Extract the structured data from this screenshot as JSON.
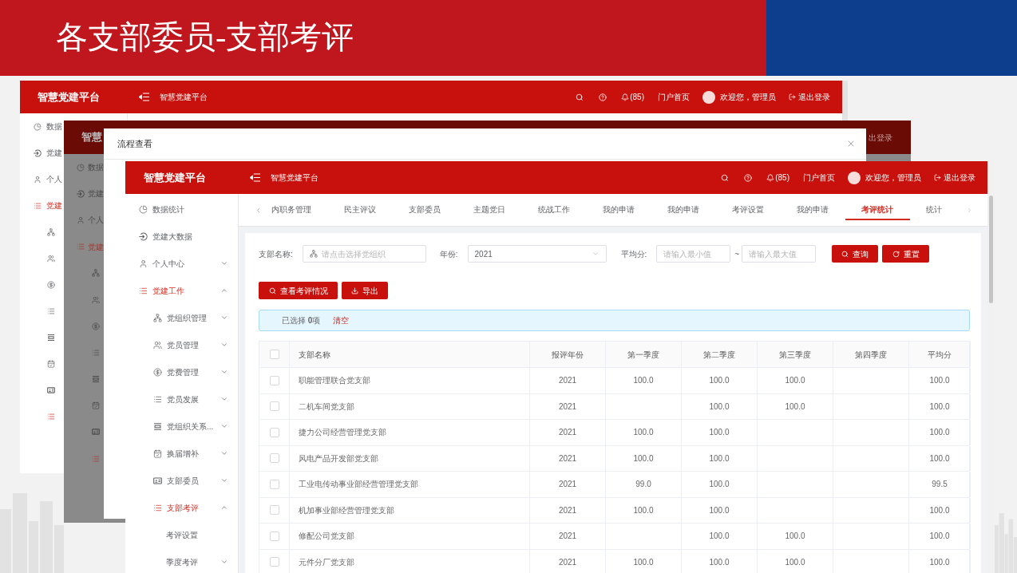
{
  "slide": {
    "title": "各支部委员-支部考评"
  },
  "back_window": {
    "header": {
      "logo": "智慧党建平台",
      "breadcrumb": "智慧党建平台",
      "notifications": "(85)",
      "portal_link": "门户首页",
      "greeting": "欢迎您，管理员",
      "logout": "退出登录"
    },
    "sidebar": [
      {
        "label": "数据",
        "active": false
      },
      {
        "label": "党建",
        "active": false
      },
      {
        "label": "个人",
        "active": false
      },
      {
        "label": "党建",
        "active": true,
        "children": [
          {
            "active": false
          },
          {
            "active": false
          },
          {
            "active": false
          },
          {
            "active": false
          },
          {
            "active": false
          },
          {
            "active": false
          },
          {
            "active": false
          },
          {
            "active": true
          }
        ]
      }
    ]
  },
  "dimmed_window": {
    "header": {
      "logo": "智慧",
      "logout": "出登录"
    },
    "sidebar": [
      {
        "label": "数据",
        "active": false
      },
      {
        "label": "党建",
        "active": false
      },
      {
        "label": "个人",
        "active": false
      },
      {
        "label": "党建",
        "active": true,
        "children": [
          {
            "active": false
          },
          {
            "active": false
          },
          {
            "active": false
          },
          {
            "active": false
          },
          {
            "active": false
          },
          {
            "active": false
          },
          {
            "active": false
          },
          {
            "active": true
          }
        ]
      }
    ]
  },
  "dialog": {
    "title": "流程查看"
  },
  "front_window": {
    "header": {
      "logo": "智慧党建平台",
      "breadcrumb": "智慧党建平台",
      "notifications": "(85)",
      "portal_link": "门户首页",
      "greeting": "欢迎您，管理员",
      "logout": "退出登录"
    },
    "sidebar": [
      {
        "label": "数据统计",
        "active": false
      },
      {
        "label": "党建大数据",
        "active": false
      },
      {
        "label": "个人中心",
        "active": false,
        "expanded": false
      },
      {
        "label": "党建工作",
        "active": true,
        "expanded": true,
        "children": [
          {
            "label": "党组织管理",
            "active": false,
            "expanded": false
          },
          {
            "label": "党员管理",
            "active": false,
            "expanded": false
          },
          {
            "label": "党费管理",
            "active": false,
            "expanded": false
          },
          {
            "label": "党员发展",
            "active": false,
            "expanded": false
          },
          {
            "label": "党组织关系...",
            "active": false,
            "expanded": false
          },
          {
            "label": "换届增补",
            "active": false,
            "expanded": false
          },
          {
            "label": "支部委员",
            "active": false,
            "expanded": false
          },
          {
            "label": "支部考评",
            "active": true,
            "expanded": true,
            "children": [
              {
                "label": "考评设置",
                "active": false
              },
              {
                "label": "季度考评",
                "active": false,
                "expanded": false
              }
            ]
          }
        ]
      }
    ],
    "tabs": [
      {
        "label": "内职务管理",
        "selected": false
      },
      {
        "label": "民主评议",
        "selected": false
      },
      {
        "label": "支部委员",
        "selected": false
      },
      {
        "label": "主题党日",
        "selected": false
      },
      {
        "label": "统战工作",
        "selected": false
      },
      {
        "label": "我的申请",
        "selected": false
      },
      {
        "label": "我的申请",
        "selected": false
      },
      {
        "label": "考评设置",
        "selected": false
      },
      {
        "label": "我的申请",
        "selected": false
      },
      {
        "label": "考评统计",
        "selected": true
      },
      {
        "label": "统计",
        "selected": false
      }
    ],
    "filters": {
      "branch": {
        "label": "支部名称:",
        "placeholder": "请点击选择党组织"
      },
      "year": {
        "label": "年份:",
        "value": "2021"
      },
      "average": {
        "label": "平均分:",
        "min_placeholder": "请输入最小值",
        "separator": "~",
        "max_placeholder": "请输入最大值"
      },
      "buttons": [
        "查询",
        "重置"
      ]
    },
    "actions": [
      "查看考评情况",
      "导出"
    ],
    "selection": {
      "text": "已选择 **0**项",
      "clear": "清空"
    },
    "table": {
      "all_checked": false,
      "columns": [
        "支部名称",
        "报评年份",
        "第一季度",
        "第二季度",
        "第三季度",
        "第四季度",
        "平均分"
      ],
      "rows": [
        {
          "checked": false,
          "cells": [
            "职能管理联合党支部",
            "2021",
            "100.0",
            "100.0",
            "100.0",
            null,
            "100.0"
          ]
        },
        {
          "checked": false,
          "cells": [
            "二机车间党支部",
            "2021",
            null,
            "100.0",
            "100.0",
            null,
            "100.0"
          ]
        },
        {
          "checked": false,
          "cells": [
            "捷力公司经营管理党支部",
            "2021",
            "100.0",
            "100.0",
            null,
            null,
            "100.0"
          ]
        },
        {
          "checked": false,
          "cells": [
            "风电产品开发部党支部",
            "2021",
            "100.0",
            "100.0",
            null,
            null,
            "100.0"
          ]
        },
        {
          "checked": false,
          "cells": [
            "工业电传动事业部经营管理党支部",
            "2021",
            "99.0",
            "100.0",
            null,
            null,
            "99.5"
          ]
        },
        {
          "checked": false,
          "cells": [
            "机加事业部经营管理党支部",
            "2021",
            "100.0",
            "100.0",
            null,
            null,
            "100.0"
          ]
        },
        {
          "checked": false,
          "cells": [
            "修配公司党支部",
            "2021",
            null,
            "100.0",
            "100.0",
            null,
            "100.0"
          ]
        },
        {
          "checked": false,
          "cells": [
            "元件分厂党支部",
            "2021",
            "100.0",
            "100.0",
            "100.0",
            null,
            "100.0"
          ]
        }
      ]
    }
  }
}
